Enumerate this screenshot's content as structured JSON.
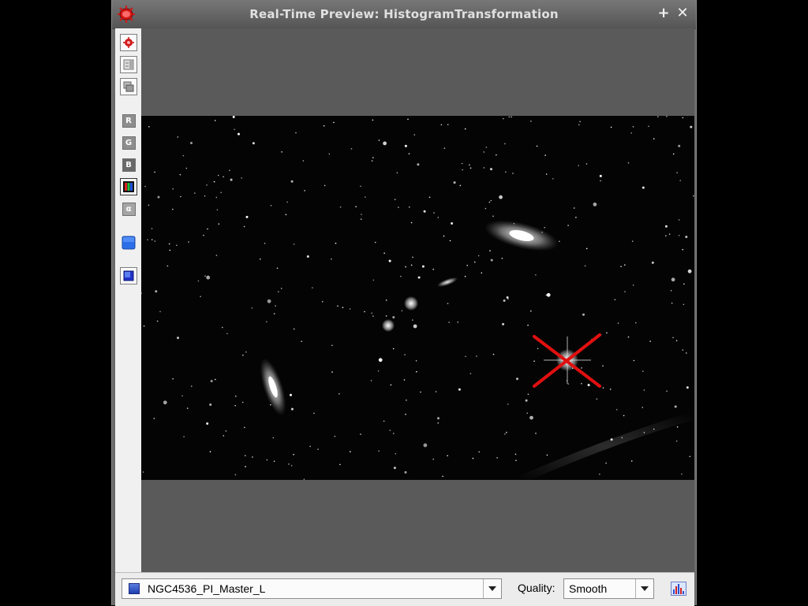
{
  "window": {
    "title": "Real-Time Preview: HistogramTransformation",
    "plus_label": "+",
    "close_label": "✕"
  },
  "toolbar": {
    "tools": [
      {
        "name": "reset-icon"
      },
      {
        "name": "fit-view-icon"
      },
      {
        "name": "window-icon"
      },
      {
        "name": "channel-r",
        "label": "R"
      },
      {
        "name": "channel-g",
        "label": "G"
      },
      {
        "name": "channel-b",
        "label": "B"
      },
      {
        "name": "channel-rgb",
        "selected": true
      },
      {
        "name": "channel-alpha",
        "label": "α"
      },
      {
        "name": "blue-square-icon"
      },
      {
        "name": "blue-square-framed-icon"
      }
    ]
  },
  "image": {
    "marker": "red-x-marker"
  },
  "statusbar": {
    "view_name": "NGC4536_PI_Master_L",
    "quality_label": "Quality:",
    "quality_value": "Smooth"
  },
  "colors": {
    "marker": "#e01010",
    "accent_blue": "#2b56d8"
  }
}
